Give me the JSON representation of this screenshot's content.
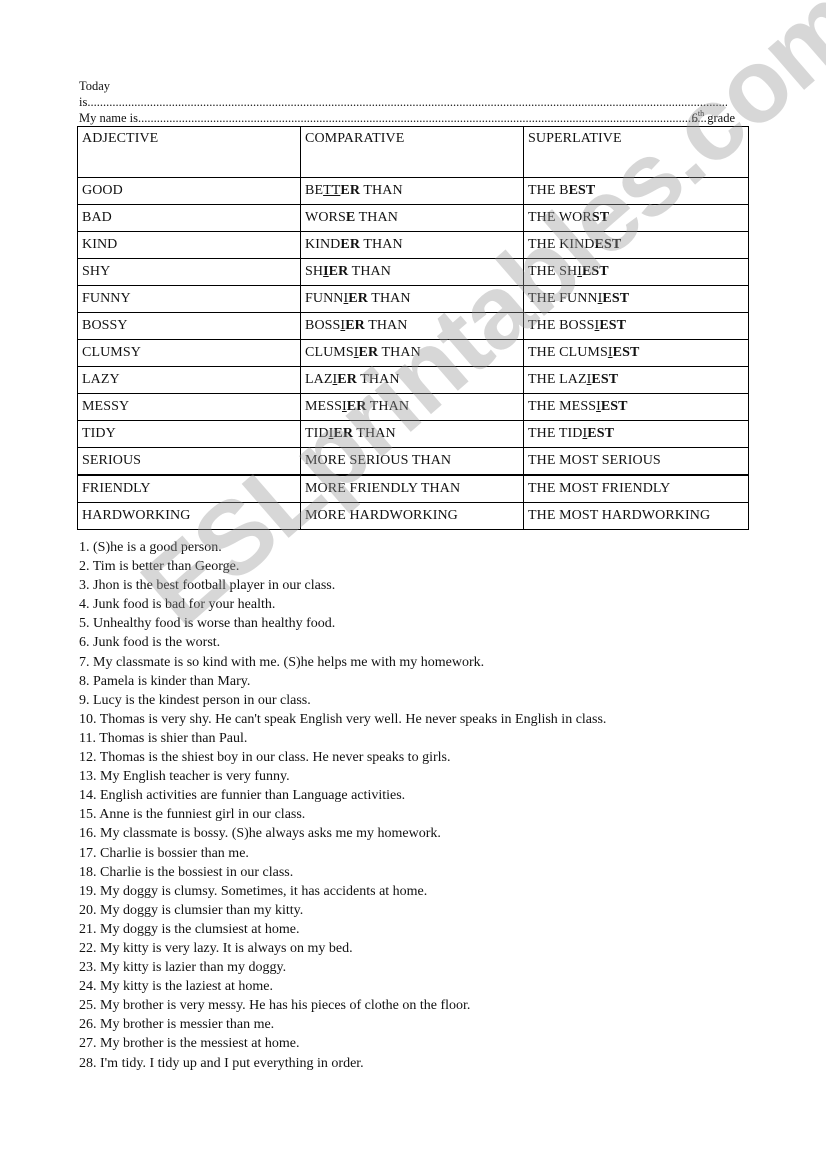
{
  "header": {
    "today_label": "Today",
    "is_label": "is",
    "is_dots": "..........................................................................................................................................................................................................................",
    "name_label": "My name is",
    "name_dots": "......................................................................................................................................................................................",
    "grade_number": "6",
    "grade_suffix": "th",
    "grade_word": " grade"
  },
  "table": {
    "columns": [
      "ADJECTIVE",
      "COMPARATIVE",
      "SUPERLATIVE"
    ],
    "rows": [
      {
        "adjective": "GOOD",
        "comparative": [
          [
            "BE",
            ""
          ],
          [
            "TT",
            "u"
          ],
          [
            "ER",
            "b"
          ],
          [
            " THAN",
            ""
          ]
        ],
        "superlative": [
          [
            "THE B",
            ""
          ],
          [
            "EST",
            "b"
          ]
        ]
      },
      {
        "adjective": "BAD",
        "comparative": [
          [
            "WORS",
            ""
          ],
          [
            "E",
            "b"
          ],
          [
            " THAN",
            ""
          ]
        ],
        "superlative": [
          [
            "THE WOR",
            ""
          ],
          [
            "ST",
            "b"
          ]
        ]
      },
      {
        "adjective": "KIND",
        "comparative": [
          [
            "KIND",
            ""
          ],
          [
            "ER",
            "b"
          ],
          [
            " THAN",
            ""
          ]
        ],
        "superlative": [
          [
            "THE KIND",
            ""
          ],
          [
            "EST",
            "b"
          ]
        ]
      },
      {
        "adjective": "SHY",
        "comparative": [
          [
            "SH",
            ""
          ],
          [
            "I",
            "bu"
          ],
          [
            "ER",
            "b"
          ],
          [
            " THAN",
            ""
          ]
        ],
        "superlative": [
          [
            "THE SH",
            ""
          ],
          [
            "I",
            "u"
          ],
          [
            "EST",
            "b"
          ]
        ]
      },
      {
        "adjective": "FUNNY",
        "comparative": [
          [
            "FUNN",
            ""
          ],
          [
            "I",
            "u"
          ],
          [
            "ER",
            "b"
          ],
          [
            " THAN",
            ""
          ]
        ],
        "superlative": [
          [
            "THE FUNN",
            ""
          ],
          [
            "I",
            "u"
          ],
          [
            "EST",
            "b"
          ]
        ]
      },
      {
        "adjective": "BOSSY",
        "comparative": [
          [
            "BOSS",
            ""
          ],
          [
            "I",
            "u"
          ],
          [
            "ER",
            "b"
          ],
          [
            " THAN",
            ""
          ]
        ],
        "superlative": [
          [
            "THE BOSS",
            ""
          ],
          [
            "I",
            "u"
          ],
          [
            "EST",
            "b"
          ]
        ]
      },
      {
        "adjective": "CLUMSY",
        "comparative": [
          [
            "CLUMS",
            ""
          ],
          [
            "I",
            "u"
          ],
          [
            "ER",
            "b"
          ],
          [
            " THAN",
            ""
          ]
        ],
        "superlative": [
          [
            "THE CLUMS",
            ""
          ],
          [
            "I",
            "u"
          ],
          [
            "EST",
            "b"
          ]
        ]
      },
      {
        "adjective": "LAZY",
        "comparative": [
          [
            "LAZ",
            ""
          ],
          [
            "I",
            "u"
          ],
          [
            "ER",
            "b"
          ],
          [
            " THAN",
            ""
          ]
        ],
        "superlative": [
          [
            "THE LAZ",
            ""
          ],
          [
            "I",
            "u"
          ],
          [
            "EST",
            "b"
          ]
        ]
      },
      {
        "adjective": "MESSY",
        "comparative": [
          [
            "MESS",
            ""
          ],
          [
            "I",
            "u"
          ],
          [
            "ER",
            "b"
          ],
          [
            " THAN",
            ""
          ]
        ],
        "superlative": [
          [
            "THE MESS",
            ""
          ],
          [
            "I",
            "u"
          ],
          [
            "EST",
            "b"
          ]
        ]
      },
      {
        "adjective": "TIDY",
        "comparative": [
          [
            "TID",
            ""
          ],
          [
            "I",
            "u"
          ],
          [
            "ER",
            "b"
          ],
          [
            " THAN",
            ""
          ]
        ],
        "superlative": [
          [
            "THE TID",
            ""
          ],
          [
            "I",
            "u"
          ],
          [
            "EST",
            "b"
          ]
        ]
      },
      {
        "adjective": "SERIOUS",
        "comparative": [
          [
            "MORE SERIOUS THAN",
            ""
          ]
        ],
        "superlative": [
          [
            "THE MOST SERIOUS",
            ""
          ]
        ]
      },
      {
        "adjective": "FRIENDLY",
        "comparative": [
          [
            "MORE FRIENDLY THAN",
            ""
          ]
        ],
        "superlative": [
          [
            "THE MOST FRIENDLY",
            ""
          ]
        ]
      },
      {
        "adjective": "HARDWORKING",
        "comparative": [
          [
            "MORE HARDWORKING",
            ""
          ]
        ],
        "superlative": [
          [
            "THE MOST HARDWORKING",
            ""
          ]
        ]
      }
    ]
  },
  "sentences": [
    "1. (S)he is a good person.",
    "2. Tim is better than George.",
    "3. Jhon is the best football player in our class.",
    "4. Junk food is bad for your health.",
    "5. Unhealthy food is worse than healthy food.",
    "6. Junk food is the worst.",
    "7. My classmate is so kind with me. (S)he helps me with my homework.",
    "8. Pamela is kinder than Mary.",
    "9. Lucy is the kindest person in our class.",
    "10. Thomas is very shy. He can't speak English very well. He never speaks in English in class.",
    "11. Thomas is shier than Paul.",
    "12. Thomas is the shiest boy in our class. He never speaks to girls.",
    "13. My English teacher is very funny.",
    "14. English activities are funnier than Language activities.",
    "15. Anne is the funniest girl in our class.",
    "16. My classmate is bossy. (S)he always asks me my homework.",
    "17. Charlie is bossier than me.",
    "18. Charlie is the bossiest in our class.",
    "19. My doggy is clumsy. Sometimes, it has accidents at home.",
    "20. My doggy is clumsier than my kitty.",
    "21. My doggy is the clumsiest at home.",
    "22. My kitty is very lazy. It is always on my bed.",
    "23. My kitty is lazier than my doggy.",
    "24. My kitty is the laziest at home.",
    "25. My brother is very messy. He has his pieces of clothe on the floor.",
    "26. My brother is messier than me.",
    "27. My brother is the messiest at home.",
    "28. I'm tidy. I tidy up and I put everything in order."
  ],
  "watermark": "ESLprintables.com"
}
